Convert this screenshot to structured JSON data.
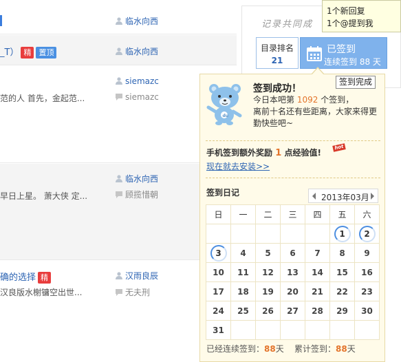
{
  "threads": [
    {
      "title": "",
      "author": "临水向西",
      "reply": ""
    },
    {
      "title": "_T）",
      "badges": [
        "精",
        "置顶"
      ],
      "author": "临水向西",
      "reply": ""
    },
    {
      "title": "",
      "snippet": "范的人 首先，金起范...",
      "author": "siemazc",
      "reply": "siemazc"
    },
    {
      "title": "",
      "snippet": "早日上星。  萧大侠 定...",
      "author": "临水向西",
      "reply": "顾揽惜朝"
    },
    {
      "title": "确的选择",
      "badges": [
        "精"
      ],
      "snippet": "汉良版水榭镛空出世...",
      "author": "汉雨良辰",
      "reply": "无夫刑"
    }
  ],
  "sidebar": {
    "title": "记录共同成",
    "rank_label": "目录排名",
    "rank_value": "21",
    "sign_state": "已签到",
    "sign_days": "连续签到 88 天"
  },
  "notice": {
    "line1": "1个新回复",
    "line2": "1个@提到我"
  },
  "sign_done_tooltip": "签到完成",
  "popup": {
    "success_title": "签到成功！",
    "rank_prefix": "今日本吧第",
    "rank_number": "1092",
    "rank_suffix": "个签到，",
    "encourage": "离前十名还有些距离，大家来得更勤快些吧~",
    "reward_prefix": "手机签到额外奖励",
    "reward_number": "1",
    "reward_suffix": "点经验值!",
    "hot_tag": "hot",
    "install_link": "现在就去安装>>",
    "diary_title": "签到日记",
    "month": "2013年03月",
    "weekdays": [
      "日",
      "一",
      "二",
      "三",
      "四",
      "五",
      "六"
    ],
    "weeks": [
      [
        "",
        "",
        "",
        "",
        "",
        "1",
        "2"
      ],
      [
        "3",
        "4",
        "5",
        "6",
        "7",
        "8",
        "9"
      ],
      [
        "10",
        "11",
        "12",
        "13",
        "14",
        "15",
        "16"
      ],
      [
        "17",
        "18",
        "19",
        "20",
        "21",
        "22",
        "23"
      ],
      [
        "24",
        "25",
        "26",
        "27",
        "28",
        "29",
        "30"
      ],
      [
        "31",
        "",
        "",
        "",
        "",
        "",
        ""
      ]
    ],
    "signed_days": [
      "1",
      "2",
      "3"
    ],
    "summary_consec_label": "已经连续签到：",
    "summary_consec_value": "88",
    "summary_total_label": "累计签到：",
    "summary_total_value": "88",
    "day_unit": "天"
  },
  "colors": {
    "link_blue": "#2d64b3",
    "accent_orange": "#e3742b",
    "sign_button": "#7fb2ec",
    "popup_bg": "#fffbe9"
  }
}
